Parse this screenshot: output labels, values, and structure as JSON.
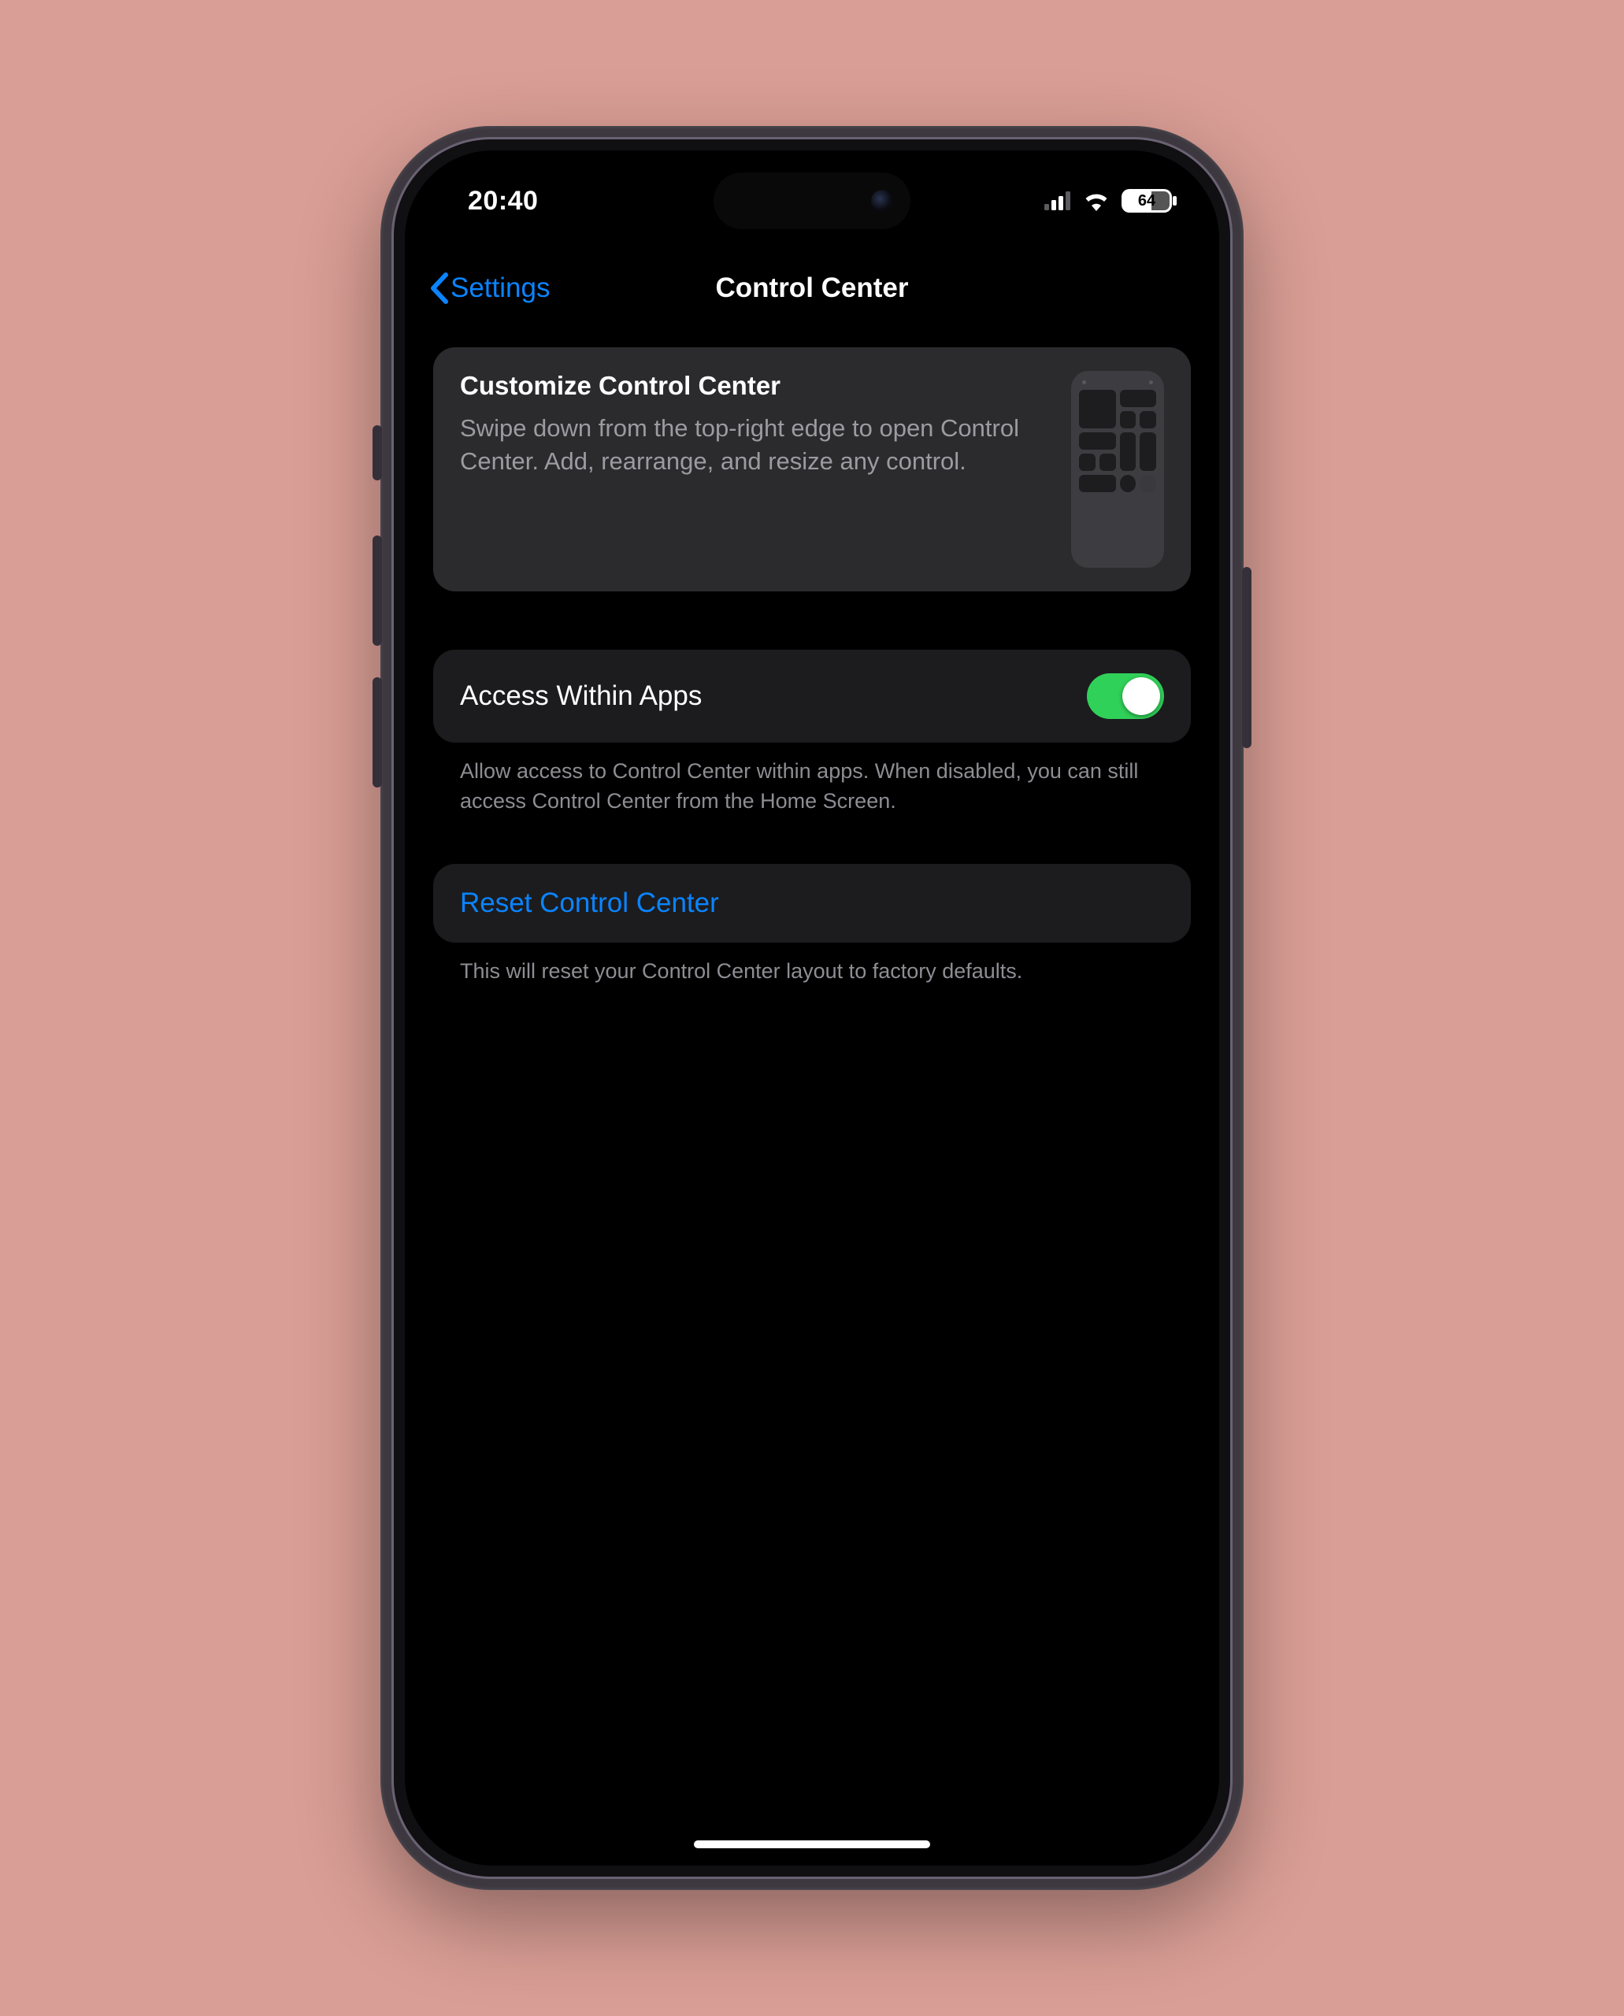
{
  "statusBar": {
    "time": "20:40",
    "battery": "64"
  },
  "nav": {
    "back": "Settings",
    "title": "Control Center"
  },
  "customize": {
    "title": "Customize Control Center",
    "desc": "Swipe down from the top-right edge to open Control Center. Add, rearrange, and resize any control."
  },
  "access": {
    "label": "Access Within Apps",
    "footer": "Allow access to Control Center within apps. When disabled, you can still access Control Center from the Home Screen."
  },
  "reset": {
    "label": "Reset Control Center",
    "footer": "This will reset your Control Center layout to factory defaults."
  }
}
